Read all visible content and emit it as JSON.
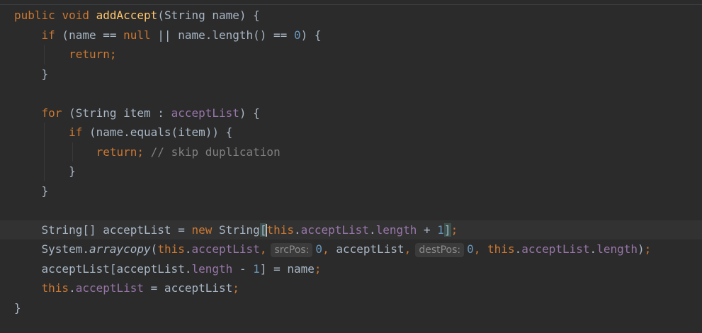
{
  "editor": {
    "lines": [
      [
        {
          "t": "kw",
          "v": "public"
        },
        {
          "t": "",
          "v": " "
        },
        {
          "t": "kw",
          "v": "void"
        },
        {
          "t": "",
          "v": " "
        },
        {
          "t": "fn",
          "v": "addAccept"
        },
        {
          "t": "",
          "v": "(String name) {"
        }
      ],
      [
        {
          "t": "",
          "v": "    "
        },
        {
          "t": "kw",
          "v": "if"
        },
        {
          "t": "",
          "v": " (name == "
        },
        {
          "t": "kw",
          "v": "null"
        },
        {
          "t": "",
          "v": " || name.length() == "
        },
        {
          "t": "num",
          "v": "0"
        },
        {
          "t": "",
          "v": ") {"
        }
      ],
      [
        {
          "t": "",
          "v": "        "
        },
        {
          "t": "kw",
          "v": "return;"
        }
      ],
      [
        {
          "t": "",
          "v": "    }"
        }
      ],
      [],
      [
        {
          "t": "",
          "v": "    "
        },
        {
          "t": "kw",
          "v": "for"
        },
        {
          "t": "",
          "v": " (String item : "
        },
        {
          "t": "field",
          "v": "acceptList"
        },
        {
          "t": "",
          "v": ") {"
        }
      ],
      [
        {
          "t": "",
          "v": "        "
        },
        {
          "t": "kw",
          "v": "if"
        },
        {
          "t": "",
          "v": " (name.equals(item)) {"
        }
      ],
      [
        {
          "t": "",
          "v": "            "
        },
        {
          "t": "kw",
          "v": "return;"
        },
        {
          "t": "",
          "v": " "
        },
        {
          "t": "cm",
          "v": "// skip duplication"
        }
      ],
      [
        {
          "t": "",
          "v": "        }"
        }
      ],
      [
        {
          "t": "",
          "v": "    }"
        }
      ],
      [],
      [
        {
          "t": "",
          "v": "    String[] acceptList = "
        },
        {
          "t": "kw",
          "v": "new"
        },
        {
          "t": "",
          "v": " String"
        },
        {
          "t": "bm",
          "v": "["
        },
        {
          "t": "caret",
          "v": ""
        },
        {
          "t": "kw",
          "v": "this"
        },
        {
          "t": "",
          "v": "."
        },
        {
          "t": "field",
          "v": "acceptList"
        },
        {
          "t": "",
          "v": "."
        },
        {
          "t": "field",
          "v": "length"
        },
        {
          "t": "",
          "v": " + "
        },
        {
          "t": "num",
          "v": "1"
        },
        {
          "t": "bm",
          "v": "]"
        },
        {
          "t": "kw",
          "v": ";"
        }
      ],
      [
        {
          "t": "",
          "v": "    System."
        },
        {
          "t": "italic",
          "v": "arraycopy"
        },
        {
          "t": "",
          "v": "("
        },
        {
          "t": "kw",
          "v": "this"
        },
        {
          "t": "",
          "v": "."
        },
        {
          "t": "field",
          "v": "acceptList"
        },
        {
          "t": "kw",
          "v": ","
        },
        {
          "t": "hint",
          "v": "srcPos:"
        },
        {
          "t": "num",
          "v": "0"
        },
        {
          "t": "kw",
          "v": ","
        },
        {
          "t": "",
          "v": " acceptList"
        },
        {
          "t": "kw",
          "v": ","
        },
        {
          "t": "hint",
          "v": "destPos:"
        },
        {
          "t": "num",
          "v": "0"
        },
        {
          "t": "kw",
          "v": ","
        },
        {
          "t": "",
          "v": " "
        },
        {
          "t": "kw",
          "v": "this"
        },
        {
          "t": "",
          "v": "."
        },
        {
          "t": "field",
          "v": "acceptList"
        },
        {
          "t": "",
          "v": "."
        },
        {
          "t": "field",
          "v": "length"
        },
        {
          "t": "",
          "v": ")"
        },
        {
          "t": "kw",
          "v": ";"
        }
      ],
      [
        {
          "t": "",
          "v": "    acceptList[acceptList."
        },
        {
          "t": "field",
          "v": "length"
        },
        {
          "t": "",
          "v": " - "
        },
        {
          "t": "num",
          "v": "1"
        },
        {
          "t": "",
          "v": "] = name"
        },
        {
          "t": "kw",
          "v": ";"
        }
      ],
      [
        {
          "t": "",
          "v": "    "
        },
        {
          "t": "kw",
          "v": "this"
        },
        {
          "t": "",
          "v": "."
        },
        {
          "t": "field",
          "v": "acceptList"
        },
        {
          "t": "",
          "v": " = acceptList"
        },
        {
          "t": "kw",
          "v": ";"
        }
      ],
      [
        {
          "t": "",
          "v": "}"
        }
      ]
    ],
    "current_line": 11,
    "colors": {
      "background": "#2b2b2b",
      "keyword": "#cc7832",
      "method": "#ffc66d",
      "field": "#9876aa",
      "number": "#6897bb",
      "comment": "#808080",
      "text": "#a9b7c6"
    }
  }
}
